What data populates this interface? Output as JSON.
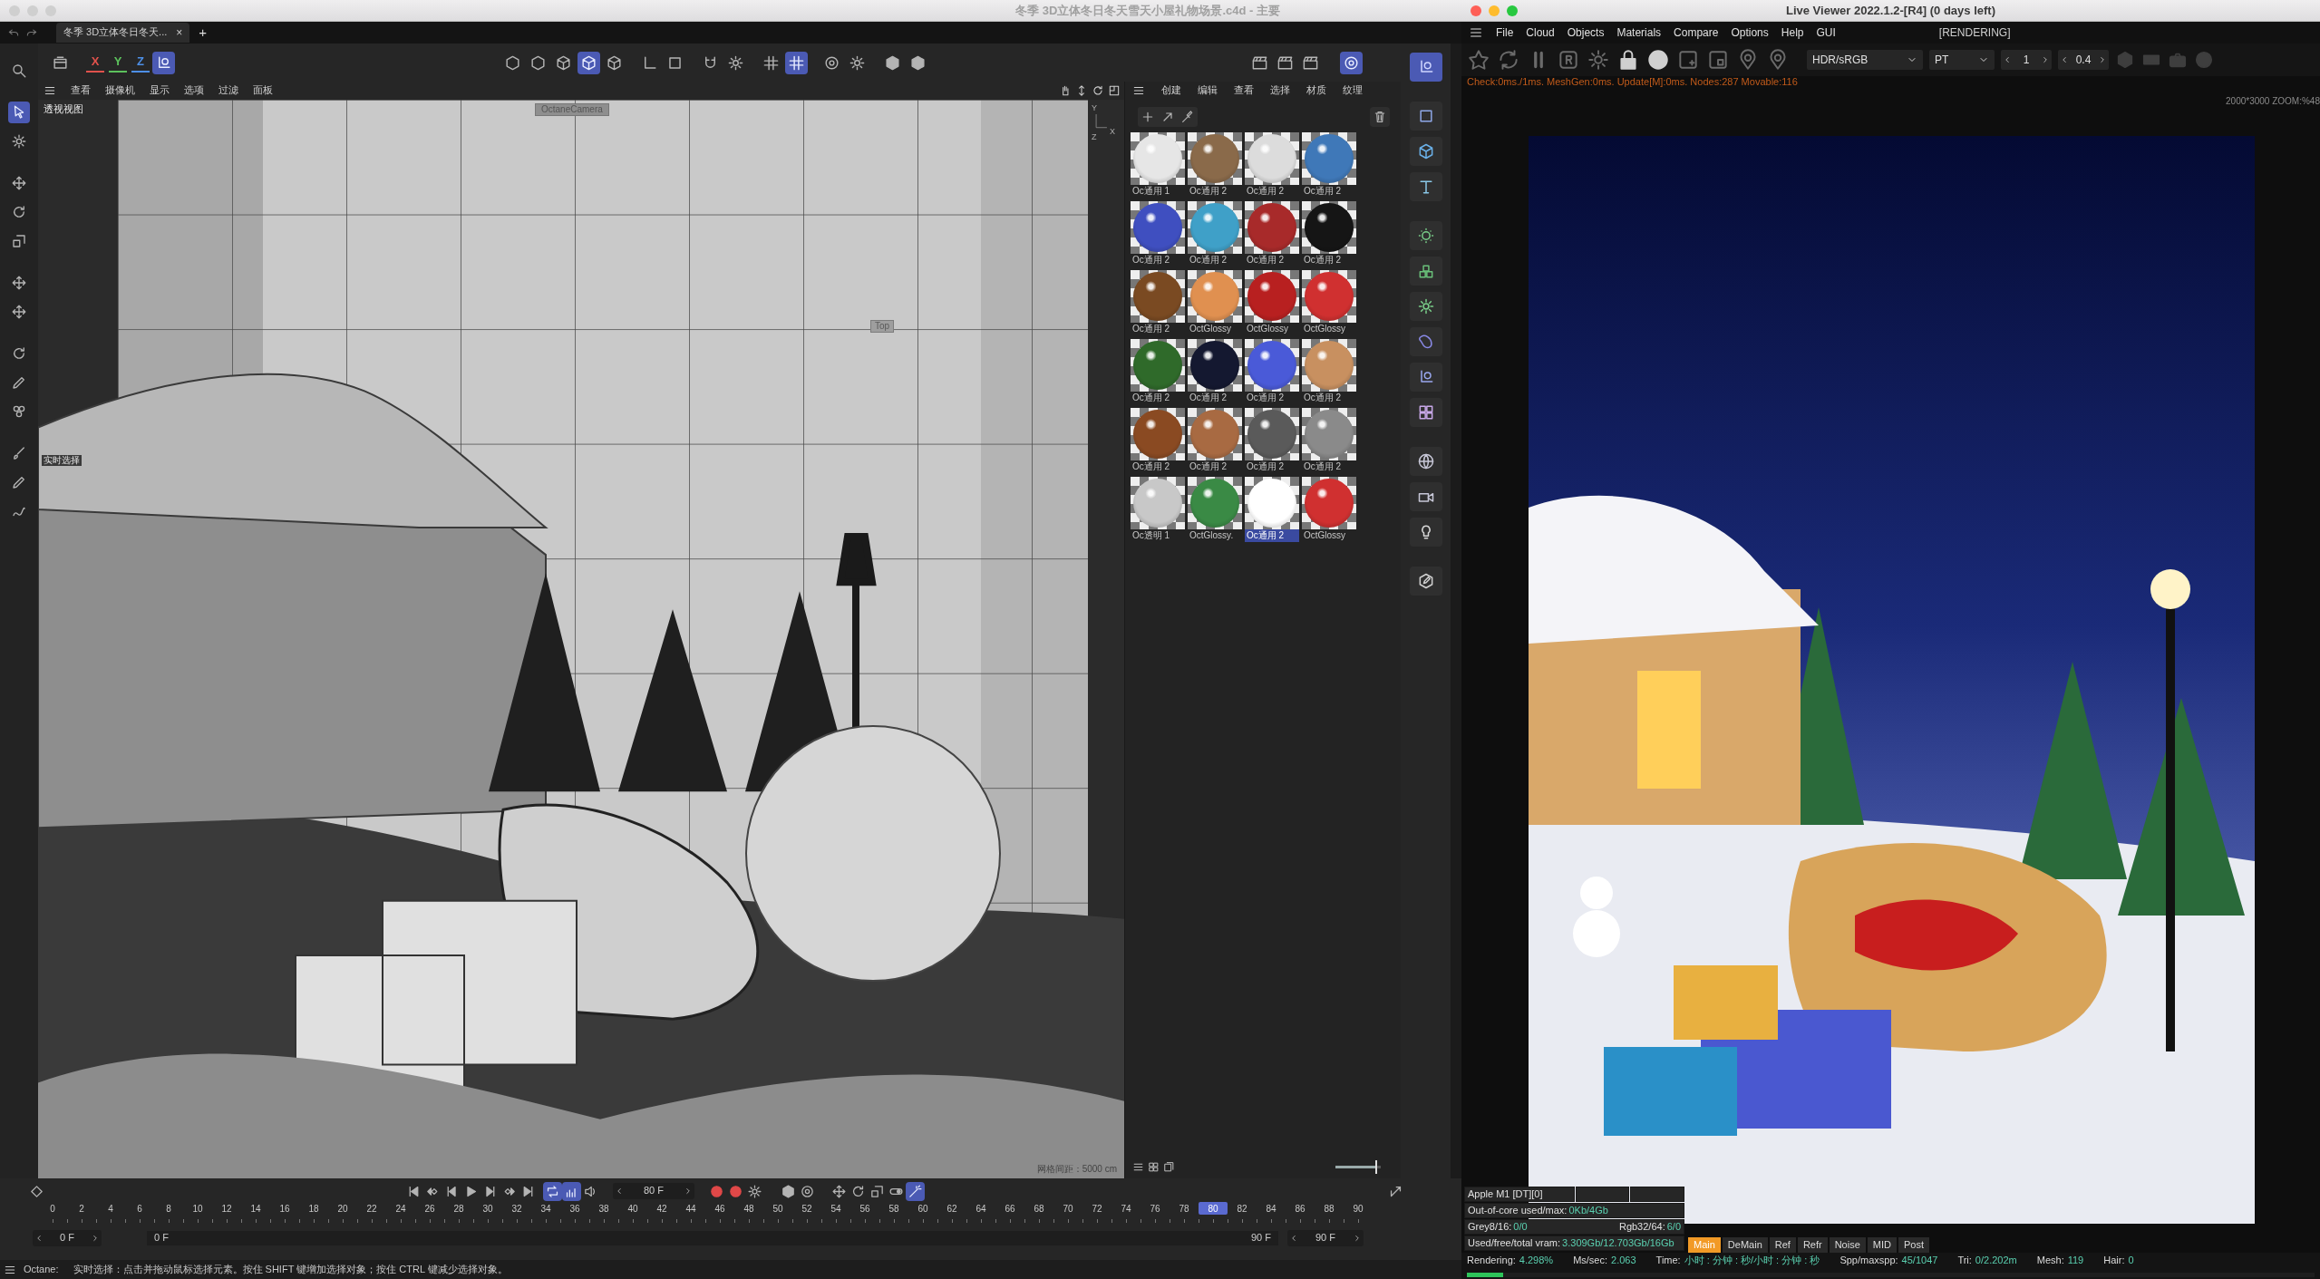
{
  "c4d": {
    "title": "冬季 3D立体冬日冬天雪天小屋礼物场景.c4d - 主要",
    "tabs": [
      {
        "label": "冬季 3D立体冬日冬天...",
        "selected": true,
        "close": "×"
      }
    ],
    "new_tab": "+",
    "toolbar": {
      "axes": [
        {
          "label": "X",
          "color": "#e0524c"
        },
        {
          "label": "Y",
          "color": "#5cc15c"
        },
        {
          "label": "Z",
          "color": "#4d8fe6"
        }
      ],
      "groups": [
        [
          {
            "on": false
          }
        ],
        [
          {
            "on": true
          }
        ],
        [
          {
            "on": false
          },
          {
            "on": false
          },
          {
            "on": false
          },
          {
            "on": true
          },
          {
            "on": false
          }
        ],
        [
          {
            "on": false
          },
          {
            "on": false
          }
        ],
        [
          {
            "on": false
          },
          {
            "on": false
          }
        ],
        [
          {
            "on": false
          },
          {
            "on": true
          }
        ],
        [
          {
            "on": false
          },
          {
            "on": false
          }
        ],
        [
          {
            "on": false
          },
          {
            "on": false
          }
        ],
        [
          {
            "on": false
          },
          {
            "on": false
          },
          {
            "on": false
          }
        ],
        [
          {
            "on": true
          }
        ]
      ]
    },
    "left_tools": [
      {
        "on": false
      },
      {
        "on": true
      },
      {
        "on": false
      },
      {
        "on": false
      },
      {
        "on": false
      },
      {
        "on": false
      },
      {
        "on": false
      },
      {
        "on": false
      },
      {
        "on": false
      },
      {
        "on": false
      },
      {
        "on": false
      },
      {
        "on": false
      },
      {
        "on": false
      },
      {
        "on": false
      }
    ],
    "viewport": {
      "menu": [
        "查看",
        "摄像机",
        "显示",
        "选项",
        "过滤",
        "面板"
      ],
      "view_label": "透视视图",
      "camera": "OctaneCamera",
      "hint": "实时选择",
      "top_tag": "Top",
      "axes": [
        "Y",
        "X",
        "Z"
      ],
      "grid_spacing": "网格间距：5000 cm",
      "render": {
        "kind": "picture"
      }
    },
    "materials": {
      "menu": [
        "创建",
        "编辑",
        "查看",
        "选择",
        "材质",
        "纹理"
      ],
      "items": [
        {
          "label": "Oc通用 1",
          "color": "#e6e6e6",
          "selected": false
        },
        {
          "label": "Oc通用 2",
          "color": "#8a6a4a",
          "selected": false
        },
        {
          "label": "Oc通用 2",
          "color": "#dcdcdc",
          "selected": false
        },
        {
          "label": "Oc通用 2",
          "color": "#3f78b8",
          "selected": false
        },
        {
          "label": "Oc通用 2",
          "color": "#3f4fc0",
          "selected": false
        },
        {
          "label": "Oc通用 2",
          "color": "#3fa0c8",
          "selected": false
        },
        {
          "label": "Oc通用 2",
          "color": "#a82a2a",
          "selected": false
        },
        {
          "label": "Oc通用 2",
          "color": "#151515",
          "selected": false
        },
        {
          "label": "Oc通用 2",
          "color": "#7a4a22",
          "selected": false
        },
        {
          "label": "OctGlossy",
          "color": "#e09050",
          "selected": false
        },
        {
          "label": "OctGlossy",
          "color": "#b82020",
          "selected": false
        },
        {
          "label": "OctGlossy",
          "color": "#d03030",
          "selected": false
        },
        {
          "label": "Oc通用 2",
          "color": "#2f6a2a",
          "selected": false
        },
        {
          "label": "Oc通用 2",
          "color": "#141830",
          "selected": false
        },
        {
          "label": "Oc通用 2",
          "color": "#4a5ad8",
          "selected": false
        },
        {
          "label": "Oc通用 2",
          "color": "#c89060",
          "selected": false
        },
        {
          "label": "Oc通用 2",
          "color": "#8a4a22",
          "selected": false
        },
        {
          "label": "Oc通用 2",
          "color": "#a86a42",
          "selected": false
        },
        {
          "label": "Oc通用 2",
          "color": "#5a5a5a",
          "selected": false
        },
        {
          "label": "Oc通用 2",
          "color": "#8a8a8a",
          "selected": false
        },
        {
          "label": "Oc透明 1",
          "color": "#c8c8c8",
          "selected": false
        },
        {
          "label": "OctGlossy.",
          "color": "#3a8a45",
          "selected": false
        },
        {
          "label": "Oc通用 2",
          "color": "#ffffff",
          "selected": true
        },
        {
          "label": "OctGlossy",
          "color": "#d03030",
          "selected": false
        }
      ],
      "thumbnail_size": {
        "level": 0.88
      }
    },
    "palette": [
      {
        "on": true
      },
      {
        "on": false
      },
      {
        "on": false
      },
      {
        "on": false
      },
      {
        "on": false
      },
      {
        "on": false
      },
      {
        "on": false
      },
      {
        "on": false
      },
      {
        "on": false
      },
      {
        "on": false
      },
      {
        "on": false
      },
      {
        "on": false
      },
      {
        "on": false
      },
      {
        "on": false
      }
    ],
    "timeline": {
      "controls": [
        {
          "on": false
        },
        {
          "on": false
        },
        {
          "on": false
        },
        {
          "on": false
        },
        {
          "on": false
        },
        {
          "on": false
        },
        {
          "on": false
        },
        {
          "on": false
        },
        {
          "on": true
        },
        {
          "on": true
        },
        {
          "on": false
        },
        {
          "on": false
        },
        {
          "on": false
        },
        {
          "on": false
        },
        {
          "on": false
        },
        {
          "on": false
        },
        {
          "on": false
        },
        {
          "on": false
        },
        {
          "on": false
        },
        {
          "on": false
        },
        {
          "on": true
        },
        {
          "on": false
        }
      ],
      "frame": "80 F",
      "ticks": [
        {
          "label": "0",
          "selected": false
        },
        {
          "label": "2",
          "selected": false
        },
        {
          "label": "4",
          "selected": false
        },
        {
          "label": "6",
          "selected": false
        },
        {
          "label": "8",
          "selected": false
        },
        {
          "label": "10",
          "selected": false
        },
        {
          "label": "12",
          "selected": false
        },
        {
          "label": "14",
          "selected": false
        },
        {
          "label": "16",
          "selected": false
        },
        {
          "label": "18",
          "selected": false
        },
        {
          "label": "20",
          "selected": false
        },
        {
          "label": "22",
          "selected": false
        },
        {
          "label": "24",
          "selected": false
        },
        {
          "label": "26",
          "selected": false
        },
        {
          "label": "28",
          "selected": false
        },
        {
          "label": "30",
          "selected": false
        },
        {
          "label": "32",
          "selected": false
        },
        {
          "label": "34",
          "selected": false
        },
        {
          "label": "36",
          "selected": false
        },
        {
          "label": "38",
          "selected": false
        },
        {
          "label": "40",
          "selected": false
        },
        {
          "label": "42",
          "selected": false
        },
        {
          "label": "44",
          "selected": false
        },
        {
          "label": "46",
          "selected": false
        },
        {
          "label": "48",
          "selected": false
        },
        {
          "label": "50",
          "selected": false
        },
        {
          "label": "52",
          "selected": false
        },
        {
          "label": "54",
          "selected": false
        },
        {
          "label": "56",
          "selected": false
        },
        {
          "label": "58",
          "selected": false
        },
        {
          "label": "60",
          "selected": false
        },
        {
          "label": "62",
          "selected": false
        },
        {
          "label": "64",
          "selected": false
        },
        {
          "label": "66",
          "selected": false
        },
        {
          "label": "68",
          "selected": false
        },
        {
          "label": "70",
          "selected": false
        },
        {
          "label": "72",
          "selected": false
        },
        {
          "label": "74",
          "selected": false
        },
        {
          "label": "76",
          "selected": false
        },
        {
          "label": "78",
          "selected": false
        },
        {
          "label": "80",
          "selected": true
        },
        {
          "label": "82",
          "selected": false
        },
        {
          "label": "84",
          "selected": false
        },
        {
          "label": "86",
          "selected": false
        },
        {
          "label": "88",
          "selected": false
        },
        {
          "label": "90",
          "selected": false
        }
      ],
      "range": [
        "0 F",
        "0 F",
        "90 F",
        "90 F"
      ]
    },
    "status_bar": {
      "label": "Octane:",
      "message": "实时选择：点击并拖动鼠标选择元素。按住 SHIFT 键增加选择对象；按住 CTRL 键减少选择对象。"
    }
  },
  "viewer": {
    "title": "Live Viewer 2022.1.2-[R4] (0 days left)",
    "menu": [
      "File",
      "Cloud",
      "Objects",
      "Materials",
      "Compare",
      "Options",
      "Help",
      "GUI"
    ],
    "state": "[RENDERING]",
    "color_space": "HDR/sRGB",
    "kernel": "PT",
    "spinners": [
      "1",
      "0.4"
    ],
    "status": "Check:0ms./1ms. MeshGen:0ms. Update[M]:0ms. Nodes:287 Movable:116",
    "resolution": "2000*3000 ZOOM:%48",
    "render": {
      "kind": "picture"
    },
    "gpu": {
      "device": "Apple M1 [DT][0]",
      "rows": [
        [
          {
            "label": "Out-of-core used/max:",
            "value": "0Kb/4Gb"
          }
        ],
        [
          {
            "label": "Grey8/16:",
            "value": "0/0"
          },
          {
            "label": "Rgb32/64:",
            "value": "6/0"
          }
        ],
        [
          {
            "label": "Used/free/total vram:",
            "value": "3.309Gb/12.703Gb/16Gb"
          }
        ]
      ]
    },
    "passes": [
      {
        "label": "Main",
        "selected": true
      },
      {
        "label": "DeMain",
        "selected": false
      },
      {
        "label": "Ref",
        "selected": false
      },
      {
        "label": "Refr",
        "selected": false
      },
      {
        "label": "Noise",
        "selected": false
      },
      {
        "label": "MID",
        "selected": false
      },
      {
        "label": "Post",
        "selected": false
      }
    ],
    "stats": [
      {
        "label": "Rendering:",
        "value": "4.298%"
      },
      {
        "label": "Ms/sec:",
        "value": "2.063"
      },
      {
        "label": "Time:",
        "value": "小时 : 分钟 : 秒/小时 : 分钟 : 秒"
      },
      {
        "label": "Spp/maxspp:",
        "value": "45/1047"
      },
      {
        "label": "Tri:",
        "value": "0/2.202m"
      },
      {
        "label": "Mesh:",
        "value": "119"
      },
      {
        "label": "Hair:",
        "value": "0"
      }
    ],
    "progress": {
      "level": 0.043
    }
  }
}
